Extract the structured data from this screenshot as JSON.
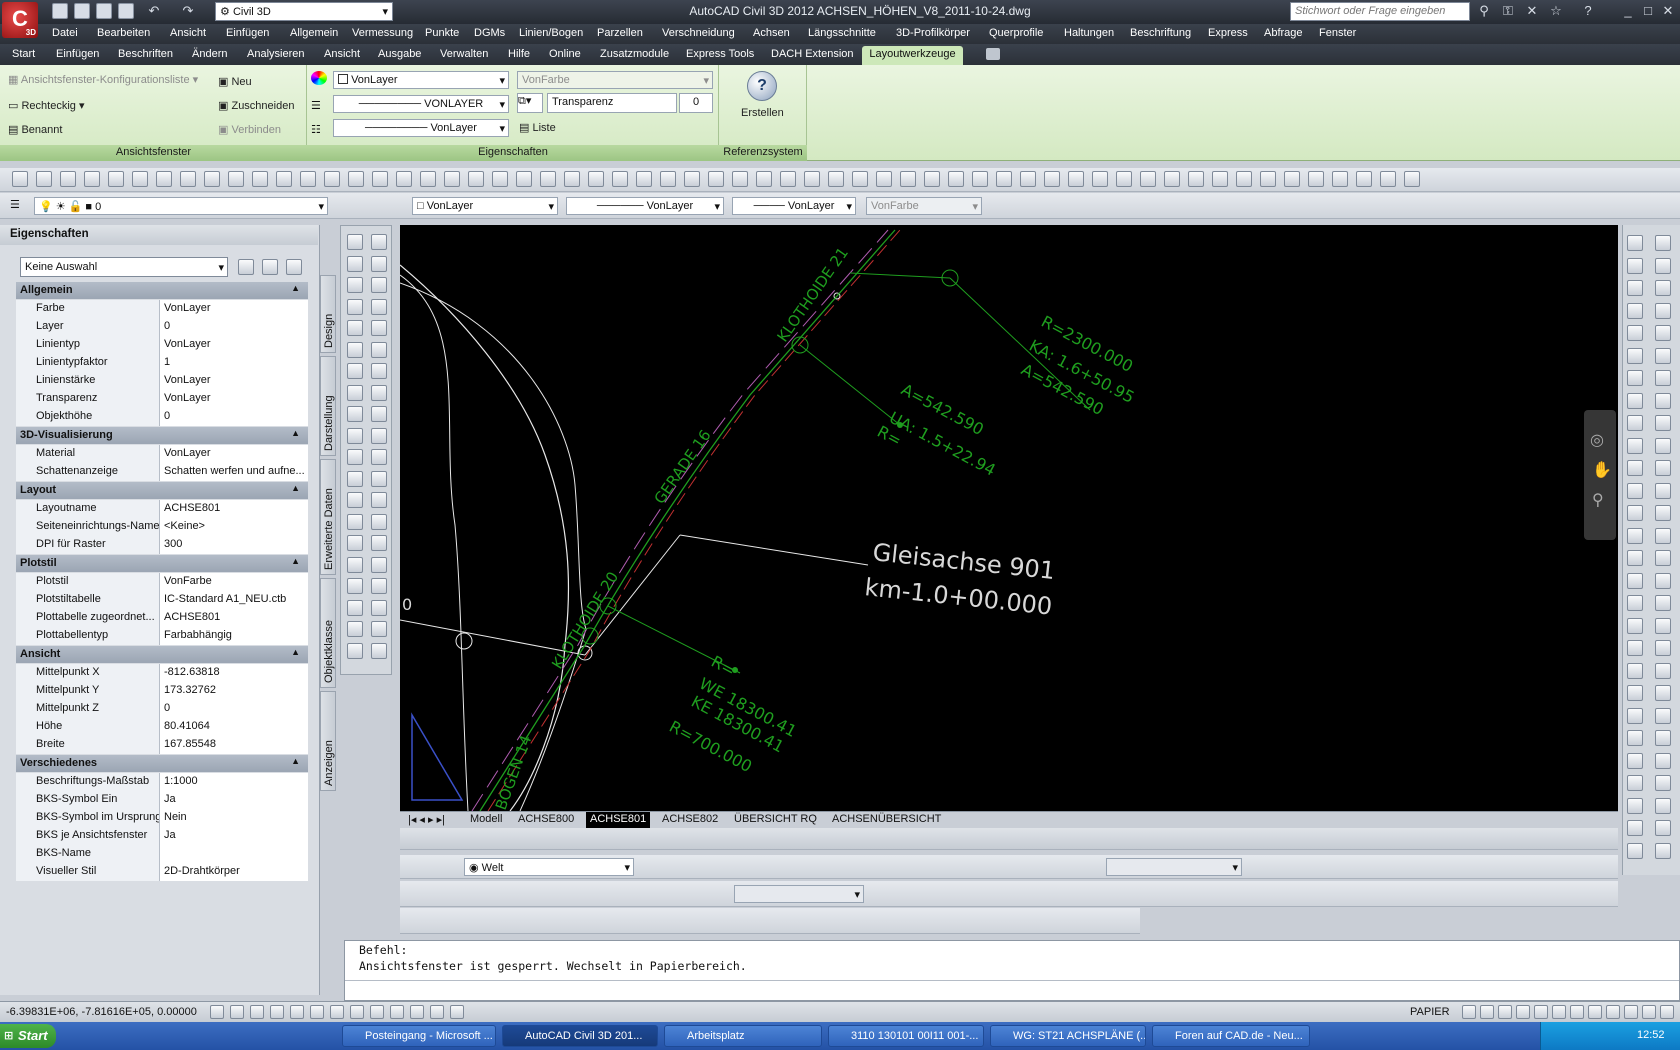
{
  "app": {
    "logo_letter": "C",
    "logo_badge": "3D",
    "workspace": "Civil 3D",
    "window_title": "AutoCAD Civil 3D 2012   ACHSEN_HÖHEN_V8_2011-10-24.dwg",
    "search_placeholder": "Stichwort oder Frage eingeben"
  },
  "menu": [
    "Datei",
    "Bearbeiten",
    "Ansicht",
    "Einfügen",
    "Allgemein",
    "Vermessung",
    "Punkte",
    "DGMs",
    "Linien/Bogen",
    "Parzellen",
    "Verschneidung",
    "Achsen",
    "Längsschnitte",
    "3D-Profilkörper",
    "Querprofile",
    "Haltungen",
    "Beschriftung",
    "Express",
    "Abfrage",
    "Fenster"
  ],
  "ribbon_tabs": [
    "Start",
    "Einfügen",
    "Beschriften",
    "Ändern",
    "Analysieren",
    "Ansicht",
    "Ausgabe",
    "Verwalten",
    "Hilfe",
    "Online",
    "Zusatzmodule",
    "Express Tools",
    "DACH Extension",
    "Layoutwerkzeuge"
  ],
  "ribbon": {
    "ansichtsfenster": {
      "title": "Ansichtsfenster",
      "config": "Ansichtsfenster-Konfigurationsliste",
      "rechteckig": "Rechteckig",
      "benannt": "Benannt",
      "neu": "Neu",
      "zuschneiden": "Zuschneiden",
      "verbinden": "Verbinden"
    },
    "eigenschaften": {
      "title": "Eigenschaften",
      "color": "VonLayer",
      "linetype": "VONLAYER",
      "lineweight": "VonLayer",
      "plotstyle": "VonFarbe",
      "transparency_label": "Transparenz",
      "transparency_value": "0",
      "liste": "Liste"
    },
    "referenzsystem": {
      "title": "Referenzsystem",
      "erstellen": "Erstellen"
    }
  },
  "layerbar": {
    "layer": "0",
    "color": "VonLayer",
    "linetype": "VonLayer",
    "lineweight": "VonLayer",
    "plotstyle": "VonFarbe"
  },
  "properties": {
    "title": "Eigenschaften",
    "selection": "Keine Auswahl",
    "sections": [
      {
        "name": "Allgemein",
        "rows": [
          [
            "Farbe",
            "VonLayer"
          ],
          [
            "Layer",
            "0"
          ],
          [
            "Linientyp",
            "VonLayer"
          ],
          [
            "Linientypfaktor",
            "1"
          ],
          [
            "Linienstärke",
            "VonLayer"
          ],
          [
            "Transparenz",
            "VonLayer"
          ],
          [
            "Objekthöhe",
            "0"
          ]
        ]
      },
      {
        "name": "3D-Visualisierung",
        "rows": [
          [
            "Material",
            "VonLayer"
          ],
          [
            "Schattenanzeige",
            "Schatten werfen und aufne..."
          ]
        ]
      },
      {
        "name": "Layout",
        "rows": [
          [
            "Layoutname",
            "ACHSE801"
          ],
          [
            "Seiteneinrichtungs-Name",
            "<Keine>"
          ],
          [
            "DPI für Raster",
            "300"
          ]
        ]
      },
      {
        "name": "Plotstil",
        "rows": [
          [
            "Plotstil",
            "VonFarbe"
          ],
          [
            "Plotstiltabelle",
            "IC-Standard A1_NEU.ctb"
          ],
          [
            "Plottabelle zugeordnet...",
            "ACHSE801"
          ],
          [
            "Plottabellentyp",
            "Farbabhängig"
          ]
        ]
      },
      {
        "name": "Ansicht",
        "rows": [
          [
            "Mittelpunkt X",
            "-812.63818"
          ],
          [
            "Mittelpunkt Y",
            "173.32762"
          ],
          [
            "Mittelpunkt Z",
            "0"
          ],
          [
            "Höhe",
            "80.41064"
          ],
          [
            "Breite",
            "167.85548"
          ]
        ]
      },
      {
        "name": "Verschiedenes",
        "rows": [
          [
            "Beschriftungs-Maßstab",
            "1:1000"
          ],
          [
            "BKS-Symbol Ein",
            "Ja"
          ],
          [
            "BKS-Symbol im Ursprung",
            "Nein"
          ],
          [
            "BKS je Ansichtsfenster",
            "Ja"
          ],
          [
            "BKS-Name",
            ""
          ],
          [
            "Visueller Stil",
            "2D-Drahtkörper"
          ]
        ]
      }
    ],
    "side_tabs": [
      "Design",
      "Darstellung",
      "Erweiterte Daten",
      "Objektklasse",
      "Anzeigen"
    ]
  },
  "drawing": {
    "labels": {
      "klothoide_top": "KLOTHOIDE 21",
      "gerade": "GERADE 16",
      "klothoide_bottom": "KLOTHOIDE 20",
      "bogen": "BOGEN 14",
      "gleisachse": "Gleisachse 901",
      "km": "km-1.0+00.000",
      "r_top": "R=2300.000",
      "ka_top": "KA: 1.6+50.95",
      "a_top": "A=542.590",
      "a_mid": "A=542.590",
      "ua_mid": "UA: 1.5+22.94",
      "r_mid": "R=",
      "r_low": "R=",
      "we_low": "WE 18300.41",
      "ke_low": "KE 18300.41",
      "r700": "R=700.000",
      "zero": "0"
    }
  },
  "layout_tabs": [
    "Modell",
    "ACHSE800",
    "ACHSE801",
    "ACHSE802",
    "ÜBERSICHT RQ",
    "ACHSENÜBERSICHT"
  ],
  "layout_active": "ACHSE801",
  "ucs_combo": "Welt",
  "command": {
    "line1": "Befehl:",
    "line2": "Ansichtsfenster ist gesperrt. Wechselt in Papierbereich."
  },
  "status": {
    "coords": "-6.39831E+06, -7.81616E+05, 0.00000",
    "space": "PAPIER"
  },
  "taskbar": {
    "start": "Start",
    "tasks": [
      "Posteingang - Microsoft ...",
      "AutoCAD Civil 3D 201...",
      "Arbeitsplatz",
      "3110 130101 00I11 001-...",
      "WG: ST21 ACHSPLÄNE (...",
      "Foren auf CAD.de - Neu..."
    ],
    "clock": "12:52"
  },
  "colors": {
    "ribbon_green": "#d4e9c2",
    "canvas": "#000000",
    "green_line": "#1f9e1f",
    "white_line": "#e8e8e8",
    "magenta": "#b05cb0",
    "red": "#c03030"
  }
}
